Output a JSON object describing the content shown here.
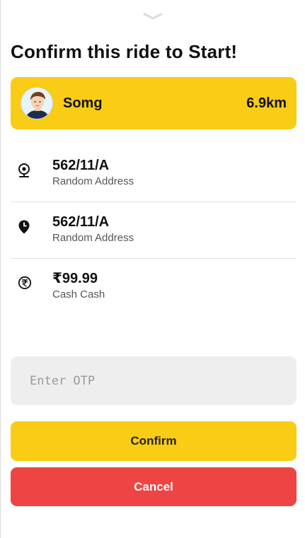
{
  "title": "Confirm this ride to Start!",
  "rider": {
    "name": "Somg",
    "distance": "6.9km"
  },
  "pickup": {
    "address": "562/11/A",
    "detail": "Random Address"
  },
  "destination": {
    "address": "562/11/A",
    "detail": "Random Address"
  },
  "payment": {
    "amount": "₹99.99",
    "method": "Cash Cash"
  },
  "otp": {
    "placeholder": "Enter OTP",
    "value": ""
  },
  "buttons": {
    "confirm_label": "Confirm",
    "cancel_label": "Cancel"
  },
  "colors": {
    "accent": "#f9cc16",
    "danger": "#ef4444",
    "input_bg": "#eeeeee"
  },
  "icons": {
    "handle": "chevron-down-icon",
    "pickup": "location-target-icon",
    "destination": "map-pin-icon",
    "payment": "rupee-icon"
  }
}
